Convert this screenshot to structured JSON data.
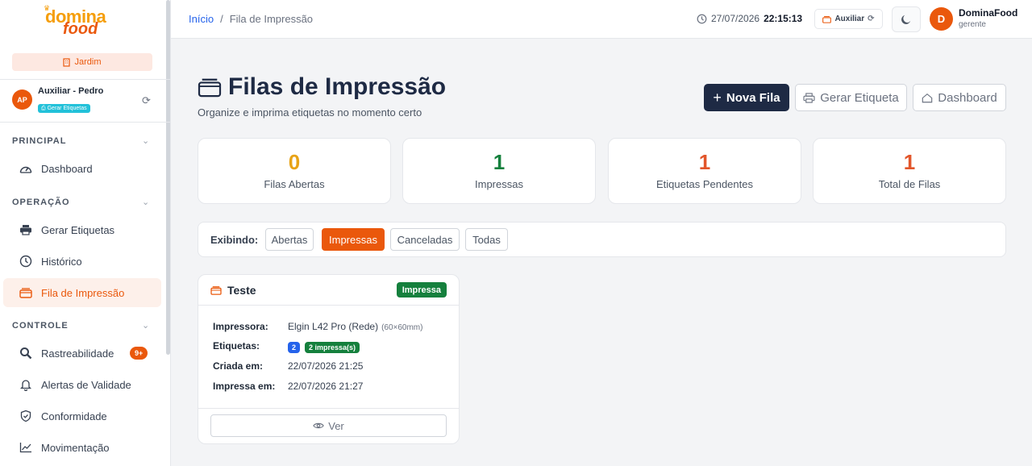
{
  "brand": {
    "logo_top": "domina",
    "logo_bottom": "food"
  },
  "sidebar": {
    "store": "Jardim",
    "user": {
      "initials": "AP",
      "name": "Auxiliar - Pedro",
      "badge": "Gerar Etiquetas"
    },
    "sections": [
      {
        "title": "PRINCIPAL",
        "items": [
          {
            "label": "Dashboard",
            "icon": "gauge-icon"
          }
        ]
      },
      {
        "title": "OPERAÇÃO",
        "items": [
          {
            "label": "Gerar Etiquetas",
            "icon": "printer-icon"
          },
          {
            "label": "Histórico",
            "icon": "clock-icon"
          },
          {
            "label": "Fila de Impressão",
            "icon": "tray-icon",
            "active": true
          }
        ]
      },
      {
        "title": "CONTROLE",
        "items": [
          {
            "label": "Rastreabilidade",
            "icon": "search-icon",
            "badge": "9+"
          },
          {
            "label": "Alertas de Validade",
            "icon": "bell-icon"
          },
          {
            "label": "Conformidade",
            "icon": "shield-icon"
          },
          {
            "label": "Movimentação",
            "icon": "chart-line-icon"
          }
        ]
      }
    ]
  },
  "header": {
    "breadcrumb": {
      "home": "Início",
      "separator": "/",
      "current": "Fila de Impressão"
    },
    "date": "27/07/2026",
    "time": "22:15:13",
    "mode_button": "Auxiliar",
    "user": {
      "initial": "D",
      "name": "DominaFood",
      "role": "gerente"
    }
  },
  "page": {
    "title": "Filas de Impressão",
    "subtitle": "Organize e imprima etiquetas no momento certo",
    "actions": {
      "new_queue": "Nova Fila",
      "generate_label": "Gerar Etiqueta",
      "dashboard": "Dashboard"
    },
    "stats": [
      {
        "value": "0",
        "label": "Filas Abertas",
        "color": "#e8a317"
      },
      {
        "value": "1",
        "label": "Impressas",
        "color": "#15803d"
      },
      {
        "value": "1",
        "label": "Etiquetas Pendentes",
        "color": "#e2562b"
      },
      {
        "value": "1",
        "label": "Total de Filas",
        "color": "#e2562b"
      }
    ],
    "filter": {
      "label": "Exibindo:",
      "options": [
        "Abertas",
        "Impressas",
        "Canceladas",
        "Todas"
      ],
      "selected": "Impressas"
    },
    "queue": {
      "name": "Teste",
      "status": "Impressa",
      "printer_label": "Impressora:",
      "printer": "Elgin L42 Pro (Rede)",
      "printer_size": "(60×60mm)",
      "labels_label": "Etiquetas:",
      "labels_count": "2",
      "labels_printed": "2 impressa(s)",
      "created_label": "Criada em:",
      "created": "22/07/2026 21:25",
      "printed_label": "Impressa em:",
      "printed": "22/07/2026 21:27",
      "view_button": "Ver"
    }
  },
  "colors": {
    "accent": "#ea580c",
    "navy": "#1e2a44",
    "success": "#15803d",
    "link": "#2563eb"
  }
}
